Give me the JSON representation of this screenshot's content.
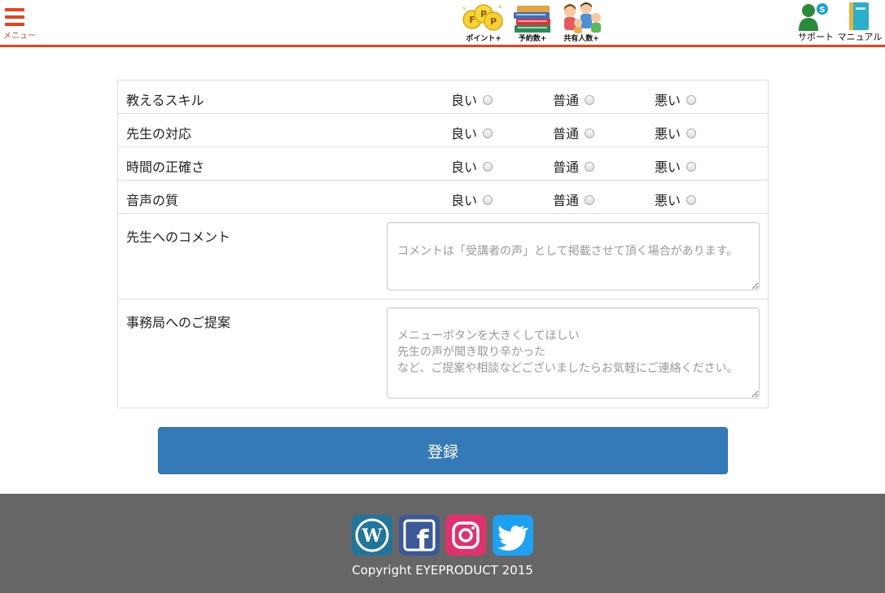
{
  "header": {
    "menu_label": "メニュー",
    "center_icons": [
      {
        "name": "point-plus",
        "label": "ポイント+"
      },
      {
        "name": "reservation-plus",
        "label": "予約数+"
      },
      {
        "name": "share-plus",
        "label": "共有人数+"
      }
    ],
    "right_icons": [
      {
        "name": "support",
        "label": "サポート"
      },
      {
        "name": "manual",
        "label": "マニュアル"
      }
    ],
    "accent_color": "#e8431f"
  },
  "form": {
    "options": {
      "good": "良い",
      "normal": "普通",
      "bad": "悪い"
    },
    "ratings": [
      {
        "label": "教えるスキル"
      },
      {
        "label": "先生の対応"
      },
      {
        "label": "時間の正確さ"
      },
      {
        "label": "音声の質"
      }
    ],
    "comment": {
      "label": "先生へのコメント",
      "placeholder": "コメントは「受講者の声」として掲載させて頂く場合があります。"
    },
    "suggestion": {
      "label": "事務局へのご提案",
      "placeholder": "メニューボタンを大きくしてほしい\n先生の声が聞き取り辛かった\nなど、ご提案や相談などございましたらお気軽にご連絡ください。"
    },
    "submit_label": "登録",
    "button_color": "#337ab7"
  },
  "footer": {
    "social": [
      "wordpress-icon",
      "facebook-icon",
      "instagram-icon",
      "twitter-icon"
    ],
    "copyright": "Copyright EYEPRODUCT 2015",
    "background": "#666666"
  }
}
